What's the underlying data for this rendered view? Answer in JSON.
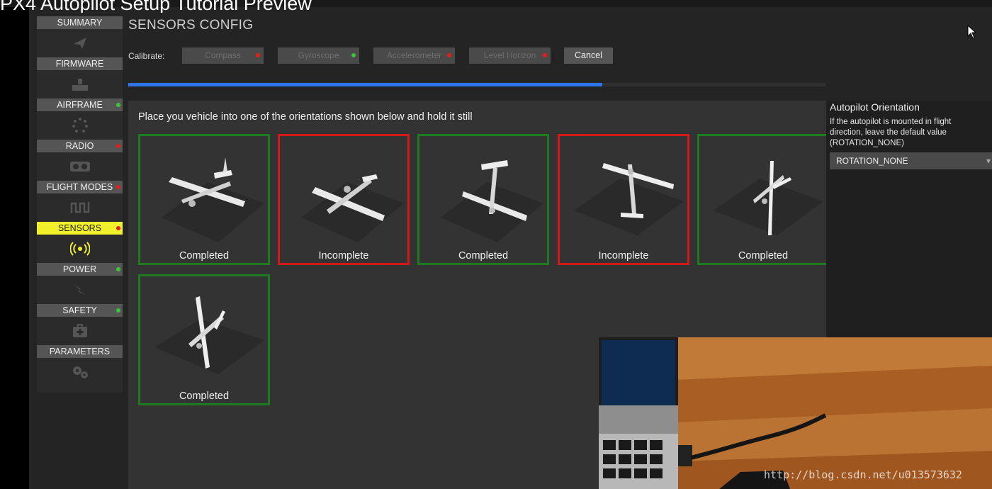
{
  "video": {
    "title": "PX4 Autopilot Setup Tutorial Preview"
  },
  "sidebar": {
    "items": [
      {
        "label": "SUMMARY",
        "status": null,
        "icon": "paper-plane-icon"
      },
      {
        "label": "FIRMWARE",
        "status": null,
        "icon": "chip-download-icon"
      },
      {
        "label": "AIRFRAME",
        "status": "#3bc43b",
        "icon": "spinner-icon"
      },
      {
        "label": "RADIO",
        "status": "#e81c1c",
        "icon": "radio-icon"
      },
      {
        "label": "FLIGHT MODES",
        "status": "#e81c1c",
        "icon": "wave-icon"
      },
      {
        "label": "SENSORS",
        "status": "#e81c1c",
        "icon": "broadcast-icon",
        "active": true
      },
      {
        "label": "POWER",
        "status": "#3bc43b",
        "icon": "bolt-icon"
      },
      {
        "label": "SAFETY",
        "status": "#3bc43b",
        "icon": "medkit-icon"
      },
      {
        "label": "PARAMETERS",
        "status": null,
        "icon": "gears-icon"
      }
    ]
  },
  "config": {
    "title": "SENSORS CONFIG",
    "calibrate_label": "Calibrate:",
    "buttons": [
      {
        "label": "Compass",
        "status": "#e81c1c"
      },
      {
        "label": "Gyroscope",
        "status": "#3bc43b"
      },
      {
        "label": "Accelerometer",
        "status": "#e81c1c"
      },
      {
        "label": "Level Horizon",
        "status": "#e81c1c"
      }
    ],
    "cancel_label": "Cancel",
    "progress": 0.68,
    "instructions": "Place you vehicle into one of the orientations shown below and hold it still",
    "orientations": [
      {
        "status": "Completed",
        "state": "complete"
      },
      {
        "status": "Incomplete",
        "state": "incomplete"
      },
      {
        "status": "Completed",
        "state": "complete"
      },
      {
        "status": "Incomplete",
        "state": "incomplete"
      },
      {
        "status": "Completed",
        "state": "complete"
      },
      {
        "status": "Completed",
        "state": "complete"
      }
    ]
  },
  "orientation_panel": {
    "title": "Autopilot Orientation",
    "description": "If the autopilot is mounted in flight direction, leave the default value (ROTATION_NONE)",
    "selected": "ROTATION_NONE"
  },
  "watermark": "http://blog.csdn.net/u013573632",
  "colors": {
    "complete": "#1e7a1e",
    "incomplete": "#d41818",
    "progress": "#2f74e8",
    "active": "#f2ef2b"
  }
}
